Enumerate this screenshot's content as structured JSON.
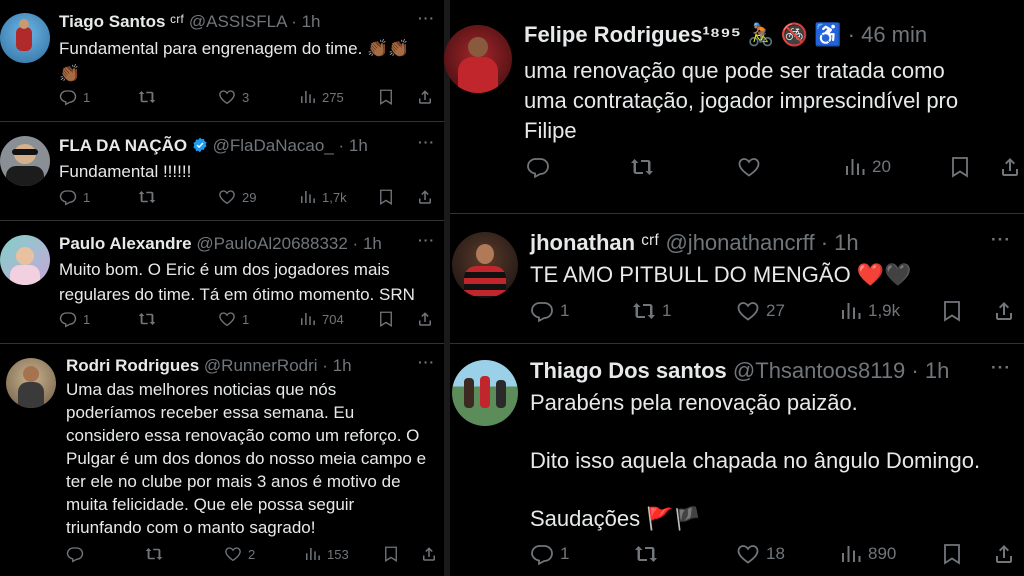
{
  "left": {
    "tweets": [
      {
        "name": "Tiago Santos",
        "badge": "ᶜʳᶠ",
        "handle": "@ASSISFLA",
        "time": "1h",
        "text_lines": [
          "Fundamental para engrenagem do time. 👏🏾👏🏾",
          "👏🏾"
        ],
        "reply": "1",
        "retweet": "",
        "like": "3",
        "views": "275"
      },
      {
        "name": "FLA DA NAÇÃO",
        "badge": "",
        "handle": "@FlaDaNacao_",
        "time": "1h",
        "text_lines": [
          "Fundamental !!!!!!"
        ],
        "reply": "1",
        "retweet": "",
        "like": "29",
        "views": "1,7k"
      },
      {
        "name": "Paulo Alexandre",
        "badge": "",
        "handle": "@PauloAl20688332",
        "time": "1h",
        "text_lines": [
          "Muito bom. O Eric é um dos jogadores mais",
          "regulares do time. Tá em ótimo momento.  SRN"
        ],
        "reply": "1",
        "retweet": "",
        "like": "1",
        "views": "704"
      },
      {
        "name": "Rodri Rodrigues",
        "badge": "",
        "handle": "@RunnerRodri",
        "time": "1h",
        "text_lines": [
          "Uma das melhores noticias que nós",
          "poderíamos receber essa semana. Eu",
          "considero essa renovação como um reforço. O",
          "Pulgar é um dos donos do nosso meia campo e",
          "ter ele no clube por mais 3 anos é motivo de",
          "muita felicidade. Que ele possa seguir",
          "triunfando com o manto sagrado!"
        ],
        "reply": "",
        "retweet": "",
        "like": "2",
        "views": "153"
      }
    ]
  },
  "right": {
    "tweets": [
      {
        "name": "Felipe Rodrigues¹⁸⁹⁵",
        "emoji": "🚴🏽 🚳 ♿",
        "handle": "",
        "time": "46 min",
        "text_lines": [
          "uma renovação que pode ser tratada como",
          "uma contratação, jogador imprescindível pro",
          "Filipe"
        ],
        "reply": "",
        "retweet": "",
        "like": "",
        "views": "20"
      },
      {
        "name": "jhonathan",
        "badge": "ᶜʳᶠ",
        "handle": "@jhonathancrff",
        "time": "1h",
        "text_lines": [
          "TE AMO PITBULL DO MENGÃO ❤️🖤"
        ],
        "reply": "1",
        "retweet": "1",
        "like": "27",
        "views": "1,9k"
      },
      {
        "name": "Thiago Dos santos",
        "badge": "",
        "handle": "@Thsantoos8119",
        "time": "1h",
        "text_lines": [
          "Parabéns pela renovação paizão.",
          "",
          "Dito isso aquela chapada no ângulo Domingo.",
          "",
          "Saudações 🚩🏴"
        ],
        "reply": "1",
        "retweet": "",
        "like": "18",
        "views": "890"
      }
    ]
  },
  "icons": {
    "more": "more-icon",
    "reply": "reply-icon",
    "retweet": "retweet-icon",
    "like": "like-icon",
    "views": "views-icon",
    "bookmark": "bookmark-icon",
    "share": "share-icon",
    "verified": "verified-badge-icon"
  },
  "colors": {
    "background": "#000000",
    "text": "#e7e9ea",
    "muted": "#71767b",
    "divider": "#2f3336",
    "verified": "#1d9bf0"
  }
}
